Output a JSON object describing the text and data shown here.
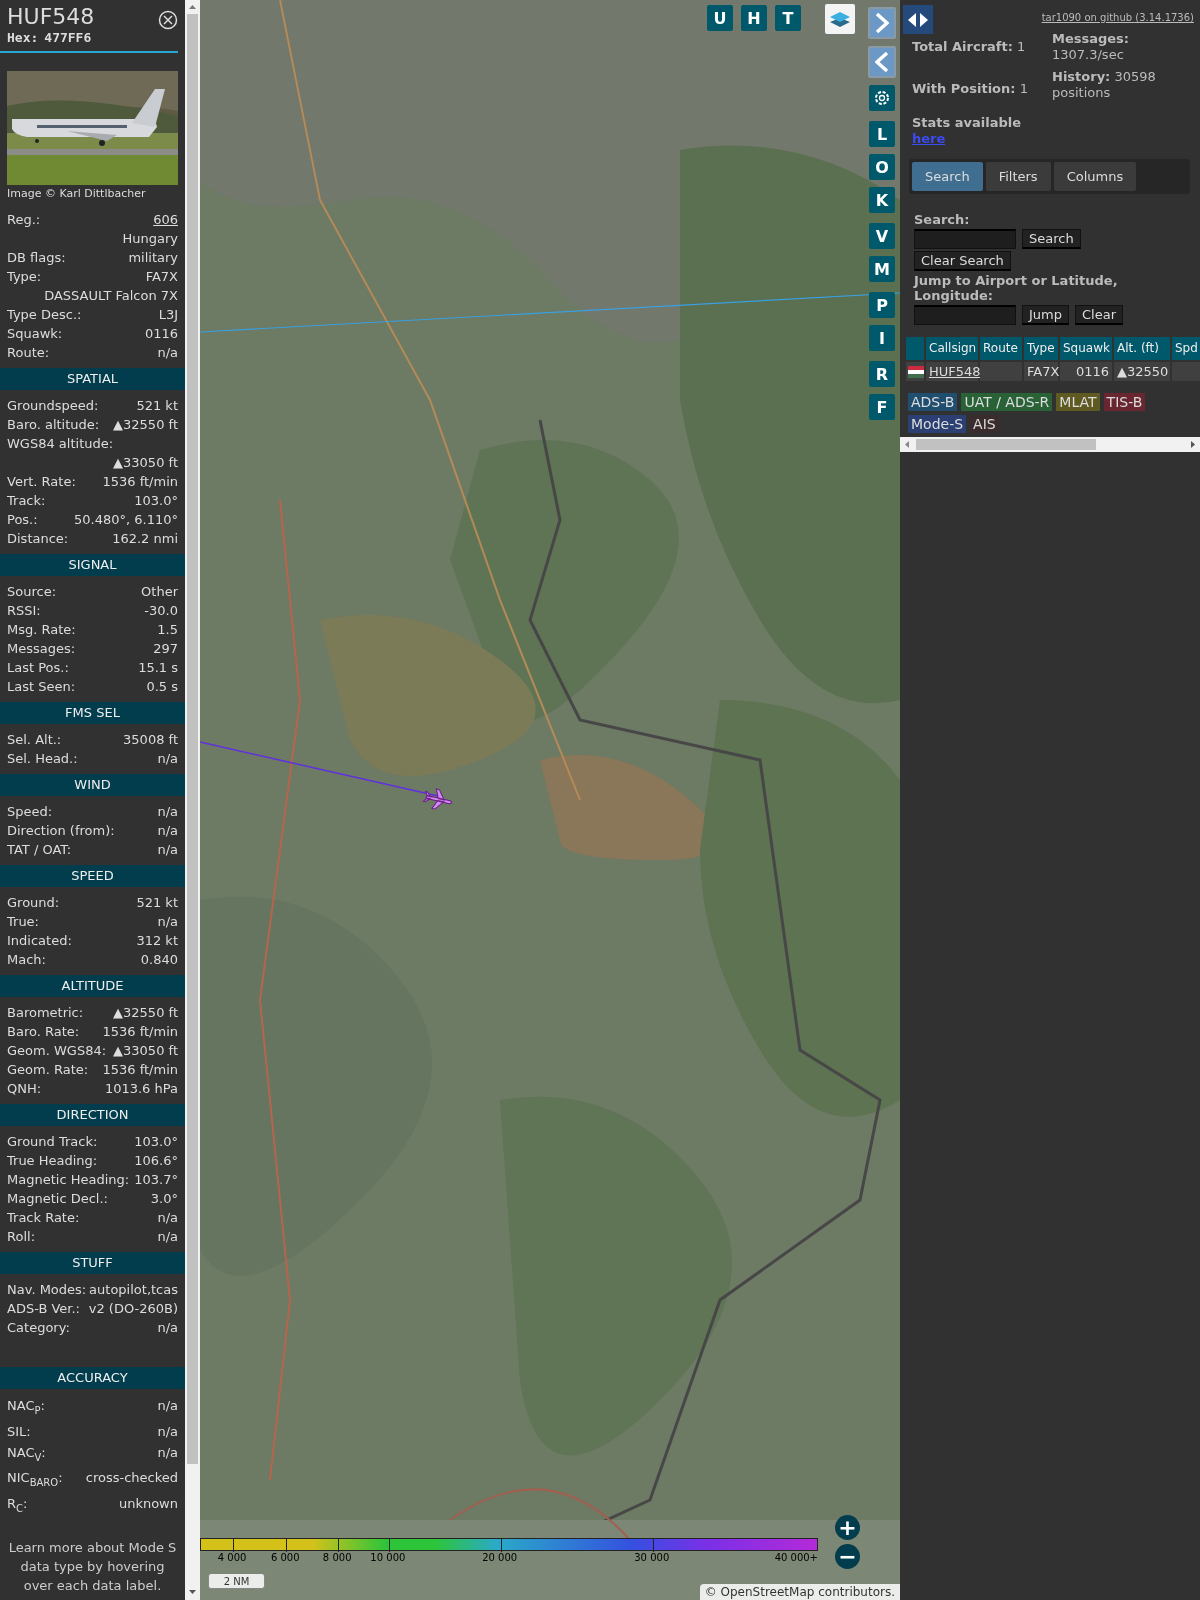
{
  "detail_panel": {
    "callsign": "HUF548",
    "hex_label": "Hex:",
    "hex": "477FF6",
    "photo": {
      "kind": "picture",
      "credit": "Image © Karl Dittlbacher"
    },
    "top_rows": [
      {
        "label": "Reg.:",
        "value": "606",
        "link": true
      },
      {
        "value": "Hungary"
      },
      {
        "label": "DB flags:",
        "value": "military"
      },
      {
        "label": "Type:",
        "value": "FA7X"
      },
      {
        "value": "DASSAULT Falcon 7X"
      },
      {
        "label": "Type Desc.:",
        "value": "L3J"
      },
      {
        "label": "Squawk:",
        "value": "0116"
      },
      {
        "label": "Route:",
        "value": "n/a"
      }
    ],
    "sections": [
      {
        "title": "SPATIAL",
        "rows": [
          {
            "label": "Groundspeed:",
            "value": "521 kt"
          },
          {
            "label": "Baro. altitude:",
            "value": "▲32550 ft"
          },
          {
            "label": "WGS84 altitude:"
          },
          {
            "value": "▲33050 ft"
          },
          {
            "label": "Vert. Rate:",
            "value": "1536 ft/min"
          },
          {
            "label": "Track:",
            "value": "103.0°"
          },
          {
            "label": "Pos.:",
            "value": "50.480°, 6.110°"
          },
          {
            "label": "Distance:",
            "value": "162.2 nmi"
          }
        ]
      },
      {
        "title": "SIGNAL",
        "rows": [
          {
            "label": "Source:",
            "value": "Other"
          },
          {
            "label": "RSSI:",
            "value": "-30.0"
          },
          {
            "label": "Msg. Rate:",
            "value": "1.5"
          },
          {
            "label": "Messages:",
            "value": "297"
          },
          {
            "label": "Last Pos.:",
            "value": "15.1 s"
          },
          {
            "label": "Last Seen:",
            "value": "0.5 s"
          }
        ]
      },
      {
        "title": "FMS SEL",
        "rows": [
          {
            "label": "Sel. Alt.:",
            "value": "35008 ft"
          },
          {
            "label": "Sel. Head.:",
            "value": "n/a"
          }
        ]
      },
      {
        "title": "WIND",
        "rows": [
          {
            "label": "Speed:",
            "value": "n/a"
          },
          {
            "label": "Direction (from):",
            "value": "n/a"
          },
          {
            "label": "TAT / OAT:",
            "value": "n/a"
          }
        ]
      },
      {
        "title": "SPEED",
        "rows": [
          {
            "label": "Ground:",
            "value": "521 kt"
          },
          {
            "label": "True:",
            "value": "n/a"
          },
          {
            "label": "Indicated:",
            "value": "312 kt"
          },
          {
            "label": "Mach:",
            "value": "0.840"
          }
        ]
      },
      {
        "title": "ALTITUDE",
        "rows": [
          {
            "label": "Barometric:",
            "value": "▲32550 ft"
          },
          {
            "label": "Baro. Rate:",
            "value": "1536 ft/min"
          },
          {
            "label": "Geom. WGS84:",
            "value": "▲33050 ft"
          },
          {
            "label": "Geom. Rate:",
            "value": "1536 ft/min"
          },
          {
            "label": "QNH:",
            "value": "1013.6 hPa"
          }
        ]
      },
      {
        "title": "DIRECTION",
        "rows": [
          {
            "label": "Ground Track:",
            "value": "103.0°"
          },
          {
            "label": "True Heading:",
            "value": "106.6°"
          },
          {
            "label": "Magnetic Heading:",
            "value": "103.7°"
          },
          {
            "label": "Magnetic Decl.:",
            "value": "3.0°"
          },
          {
            "label": "Track Rate:",
            "value": "n/a"
          },
          {
            "label": "Roll:",
            "value": "n/a"
          }
        ]
      },
      {
        "title": "STUFF",
        "rows": [
          {
            "label": "Nav. Modes:",
            "value": "autopilot,tcas"
          },
          {
            "label": "ADS-B Ver.:",
            "value": "v2 (DO-260B)"
          },
          {
            "label": "Category:",
            "value": "n/a"
          }
        ]
      },
      {
        "title": "ACCURACY",
        "rows": [
          {
            "label": "NAC$_{P}$:",
            "value": "n/a"
          },
          {
            "label": "SIL:",
            "value": "n/a"
          },
          {
            "label": "NAC$_{V}$:",
            "value": "n/a"
          },
          {
            "label": "NIC$_{BARO}$:",
            "value": "cross-checked"
          },
          {
            "label": "R$_{C}$:",
            "value": "unknown"
          }
        ]
      }
    ],
    "footnote": "Learn more about Mode S data type by hovering over each data label."
  },
  "map": {
    "top_buttons": [
      "U",
      "H",
      "T"
    ],
    "side_groups": [
      [
        "L",
        "O",
        "K"
      ],
      [
        "V",
        "M"
      ],
      [
        "P",
        "I"
      ],
      [
        "R",
        "F"
      ]
    ],
    "zoom_buttons": [
      "+",
      "−"
    ],
    "altitude_legend": [
      "4 000",
      "6 000",
      "8 000",
      "10 000",
      "20 000",
      "30 000",
      "40 000+"
    ],
    "scale_bar": "2 NM",
    "attribution": {
      "prefix": "©",
      "link": "OpenStreetMap",
      "suffix": "contributors."
    }
  },
  "side_panel": {
    "version_link": "tar1090 on github (3.14.1736)",
    "stats": [
      {
        "label": "Total Aircraft:",
        "value": "1"
      },
      {
        "label": "With Position:",
        "value": "1"
      }
    ],
    "messages": {
      "label": "Messages:",
      "value": "1307.3/sec"
    },
    "history": {
      "label": "History:",
      "value": "30598 positions"
    },
    "stats_link": {
      "label": "Stats available",
      "link": "here"
    },
    "tabs": [
      {
        "label": "Search",
        "selected": true
      },
      {
        "label": "Filters",
        "selected": false
      },
      {
        "label": "Columns",
        "selected": false
      }
    ],
    "search_form": {
      "search_label": "Search:",
      "search_button": "Search",
      "clear_search_button": "Clear Search",
      "jump_label": "Jump to Airport or Latitude, Longitude:",
      "jump_button": "Jump",
      "clear_button": "Clear"
    },
    "table": {
      "columns": [
        "Callsign",
        "Route",
        "Type",
        "Squawk",
        "Alt. (ft)",
        "Spd"
      ],
      "rows": [
        {
          "callsign": "HUF548",
          "type": "FA7X",
          "squawk": "0116",
          "altitude": "▲32550"
        }
      ]
    },
    "source_tags": [
      {
        "label": "ADS-B",
        "color": "#1f4e6e"
      },
      {
        "label": "UAT / ADS-R",
        "color": "#2a6238"
      },
      {
        "label": "MLAT",
        "color": "#5e5a22"
      },
      {
        "label": "TIS-B",
        "color": "#6a2630"
      },
      {
        "label": "Mode-S",
        "color": "#2b3f72"
      },
      {
        "label": "AIS",
        "color": "#3a2c2c"
      }
    ]
  }
}
